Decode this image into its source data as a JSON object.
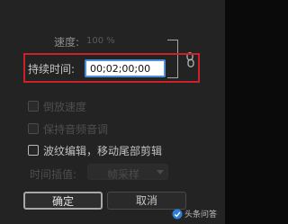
{
  "dialog": {
    "speed_label": "速度:",
    "speed_value": "100 %",
    "duration_label": "持续时间:",
    "duration_value": "00;02;00;00",
    "options": [
      {
        "label": "倒放速度",
        "checked": false,
        "enabled": false
      },
      {
        "label": "保持音频音调",
        "checked": false,
        "enabled": false
      },
      {
        "label": "波纹编辑，移动尾部剪辑",
        "checked": false,
        "enabled": true
      }
    ],
    "interpolation_label": "时间插值:",
    "interpolation_value": "帧采样",
    "ok_label": "确定",
    "cancel_label": "取消"
  },
  "icons": {
    "link": "chain-link-icon",
    "dropdown": "chevron-down-icon",
    "watermark": "site-logo-icon"
  },
  "colors": {
    "background": "#232323",
    "highlight": "#cc2129",
    "focus": "#4c8ed8"
  },
  "watermark": {
    "text": "头条问答"
  }
}
